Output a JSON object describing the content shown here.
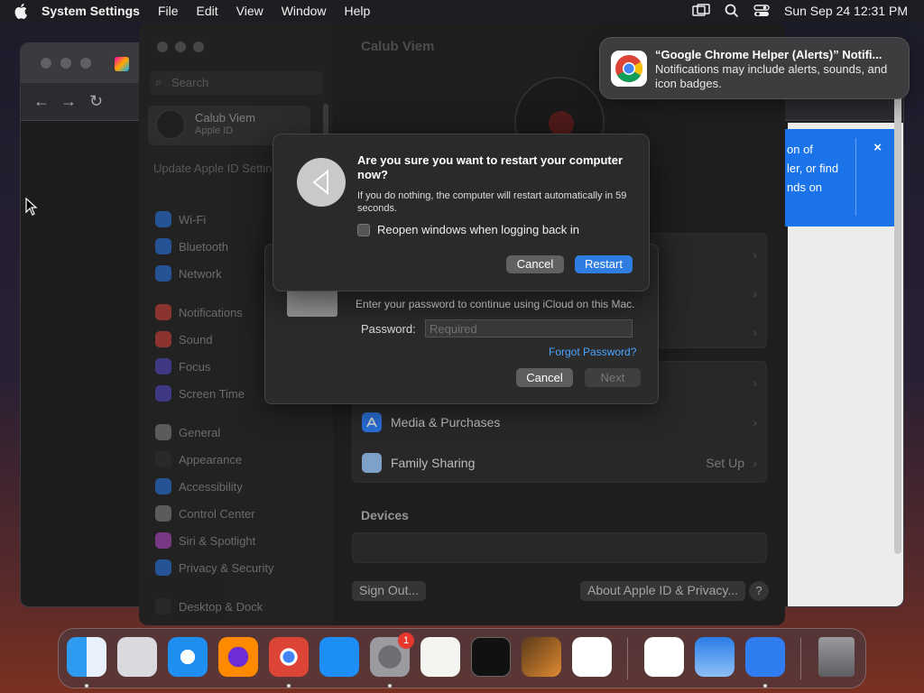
{
  "menubar": {
    "app_name": "System Settings",
    "menus": [
      "File",
      "Edit",
      "View",
      "Window",
      "Help"
    ],
    "datetime": "Sun Sep 24  12:31 PM"
  },
  "settings_window": {
    "title": "Calub Viem",
    "sidebar": {
      "search_placeholder": "Search",
      "account_name": "Calub Viem",
      "account_sub": "Apple ID",
      "update_text": "Update Apple ID Settings",
      "items": [
        {
          "label": "Wi-Fi",
          "color": "#2d7ff9"
        },
        {
          "label": "Bluetooth",
          "color": "#2d7ff9"
        },
        {
          "label": "Network",
          "color": "#2d7ff9"
        },
        {
          "label": "Notifications",
          "color": "#e5453c"
        },
        {
          "label": "Sound",
          "color": "#e5453c"
        },
        {
          "label": "Focus",
          "color": "#5b4fd6"
        },
        {
          "label": "Screen Time",
          "color": "#5b4fd6"
        },
        {
          "label": "General",
          "color": "#8e8e93"
        },
        {
          "label": "Appearance",
          "color": "#333333"
        },
        {
          "label": "Accessibility",
          "color": "#2d7ff9"
        },
        {
          "label": "Control Center",
          "color": "#8e8e93"
        },
        {
          "label": "Siri & Spotlight",
          "color": "#c04ed8"
        },
        {
          "label": "Privacy & Security",
          "color": "#2d7ff9"
        },
        {
          "label": "Desktop & Dock",
          "color": "#333333"
        }
      ]
    },
    "rows": {
      "media": "Media & Purchases",
      "family": "Family Sharing",
      "family_value": "Set Up"
    },
    "devices_heading": "Devices",
    "sign_out": "Sign Out...",
    "about": "About Apple ID & Privacy...",
    "help": "?"
  },
  "password_sheet": {
    "message": "Enter your password to continue using iCloud on this Mac.",
    "password_label": "Password:",
    "password_placeholder": "Required",
    "forgot": "Forgot Password?",
    "cancel": "Cancel",
    "next": "Next"
  },
  "restart_dialog": {
    "heading": "Are you sure you want to restart your computer now?",
    "body": "If you do nothing, the computer will restart automatically in 59 seconds.",
    "checkbox_label": "Reopen windows when logging back in",
    "checkbox_checked": false,
    "cancel": "Cancel",
    "restart": "Restart"
  },
  "notification": {
    "title": "“Google Chrome Helper (Alerts)” Notifi...",
    "body": "Notifications may include alerts, sounds, and icon badges."
  },
  "chrome_window": {
    "info_text": [
      "on of",
      "ler, or find",
      "nds on"
    ],
    "close": "×"
  },
  "dock": {
    "apps": [
      "Finder",
      "Launchpad",
      "Safari",
      "Firefox",
      "Google Chrome",
      "App Store",
      "System Settings",
      "TextEdit",
      "Terminal",
      "GarageBand",
      "Visual Studio Code",
      "Visual Studio",
      "Weather",
      "Keynote",
      "Trash"
    ],
    "settings_badge": "1"
  }
}
